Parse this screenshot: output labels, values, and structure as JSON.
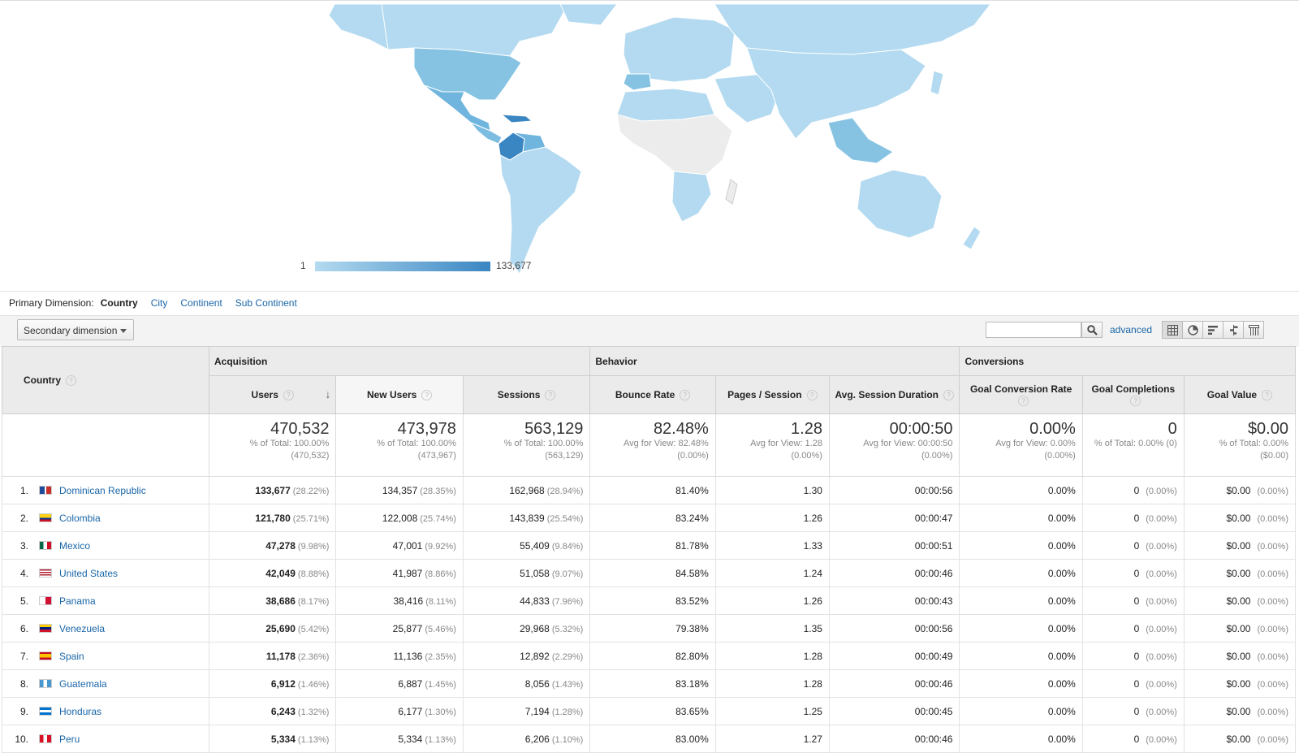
{
  "legend": {
    "min": "1",
    "max": "133,677",
    "color_low": "#b3daf0",
    "color_high": "#3a86c2"
  },
  "dimension": {
    "label": "Primary Dimension:",
    "current": "Country",
    "options": [
      "City",
      "Continent",
      "Sub Continent"
    ]
  },
  "toolbar": {
    "secondary_label": "Secondary dimension",
    "advanced_label": "advanced"
  },
  "table": {
    "country_header": "Country",
    "groups": {
      "acquisition": "Acquisition",
      "behavior": "Behavior",
      "conversions": "Conversions"
    },
    "columns": {
      "users": "Users",
      "new_users": "New Users",
      "sessions": "Sessions",
      "bounce_rate": "Bounce Rate",
      "pages_session": "Pages / Session",
      "avg_duration": "Avg. Session Duration",
      "goal_rate": "Goal Conversion Rate",
      "goal_completions": "Goal Completions",
      "goal_value": "Goal Value"
    },
    "totals": {
      "users": {
        "value": "470,532",
        "sub1": "% of Total: 100.00%",
        "sub2": "(470,532)"
      },
      "new_users": {
        "value": "473,978",
        "sub1": "% of Total: 100.00%",
        "sub2": "(473,967)"
      },
      "sessions": {
        "value": "563,129",
        "sub1": "% of Total: 100.00%",
        "sub2": "(563,129)"
      },
      "bounce_rate": {
        "value": "82.48%",
        "sub1": "Avg for View: 82.48%",
        "sub2": "(0.00%)"
      },
      "pages_session": {
        "value": "1.28",
        "sub1": "Avg for View: 1.28",
        "sub2": "(0.00%)"
      },
      "avg_duration": {
        "value": "00:00:50",
        "sub1": "Avg for View: 00:00:50",
        "sub2": "(0.00%)"
      },
      "goal_rate": {
        "value": "0.00%",
        "sub1": "Avg for View: 0.00%",
        "sub2": "(0.00%)"
      },
      "goal_completions": {
        "value": "0",
        "sub1": "% of Total: 0.00% (0)",
        "sub2": ""
      },
      "goal_value": {
        "value": "$0.00",
        "sub1": "% of Total: 0.00%",
        "sub2": "($0.00)"
      }
    },
    "rows": [
      {
        "n": "1.",
        "country": "Dominican Republic",
        "flag": "do",
        "users": "133,677",
        "users_pct": "(28.22%)",
        "new_users": "134,357",
        "new_users_pct": "(28.35%)",
        "sessions": "162,968",
        "sessions_pct": "(28.94%)",
        "bounce": "81.40%",
        "pps": "1.30",
        "dur": "00:00:56",
        "rate": "0.00%",
        "comp": "0",
        "comp_pct": "(0.00%)",
        "value": "$0.00",
        "value_pct": "(0.00%)"
      },
      {
        "n": "2.",
        "country": "Colombia",
        "flag": "co",
        "users": "121,780",
        "users_pct": "(25.71%)",
        "new_users": "122,008",
        "new_users_pct": "(25.74%)",
        "sessions": "143,839",
        "sessions_pct": "(25.54%)",
        "bounce": "83.24%",
        "pps": "1.26",
        "dur": "00:00:47",
        "rate": "0.00%",
        "comp": "0",
        "comp_pct": "(0.00%)",
        "value": "$0.00",
        "value_pct": "(0.00%)"
      },
      {
        "n": "3.",
        "country": "Mexico",
        "flag": "mx",
        "users": "47,278",
        "users_pct": "(9.98%)",
        "new_users": "47,001",
        "new_users_pct": "(9.92%)",
        "sessions": "55,409",
        "sessions_pct": "(9.84%)",
        "bounce": "81.78%",
        "pps": "1.33",
        "dur": "00:00:51",
        "rate": "0.00%",
        "comp": "0",
        "comp_pct": "(0.00%)",
        "value": "$0.00",
        "value_pct": "(0.00%)"
      },
      {
        "n": "4.",
        "country": "United States",
        "flag": "us",
        "users": "42,049",
        "users_pct": "(8.88%)",
        "new_users": "41,987",
        "new_users_pct": "(8.86%)",
        "sessions": "51,058",
        "sessions_pct": "(9.07%)",
        "bounce": "84.58%",
        "pps": "1.24",
        "dur": "00:00:46",
        "rate": "0.00%",
        "comp": "0",
        "comp_pct": "(0.00%)",
        "value": "$0.00",
        "value_pct": "(0.00%)"
      },
      {
        "n": "5.",
        "country": "Panama",
        "flag": "pa",
        "users": "38,686",
        "users_pct": "(8.17%)",
        "new_users": "38,416",
        "new_users_pct": "(8.11%)",
        "sessions": "44,833",
        "sessions_pct": "(7.96%)",
        "bounce": "83.52%",
        "pps": "1.26",
        "dur": "00:00:43",
        "rate": "0.00%",
        "comp": "0",
        "comp_pct": "(0.00%)",
        "value": "$0.00",
        "value_pct": "(0.00%)"
      },
      {
        "n": "6.",
        "country": "Venezuela",
        "flag": "ve",
        "users": "25,690",
        "users_pct": "(5.42%)",
        "new_users": "25,877",
        "new_users_pct": "(5.46%)",
        "sessions": "29,968",
        "sessions_pct": "(5.32%)",
        "bounce": "79.38%",
        "pps": "1.35",
        "dur": "00:00:56",
        "rate": "0.00%",
        "comp": "0",
        "comp_pct": "(0.00%)",
        "value": "$0.00",
        "value_pct": "(0.00%)"
      },
      {
        "n": "7.",
        "country": "Spain",
        "flag": "es",
        "users": "11,178",
        "users_pct": "(2.36%)",
        "new_users": "11,136",
        "new_users_pct": "(2.35%)",
        "sessions": "12,892",
        "sessions_pct": "(2.29%)",
        "bounce": "82.80%",
        "pps": "1.28",
        "dur": "00:00:49",
        "rate": "0.00%",
        "comp": "0",
        "comp_pct": "(0.00%)",
        "value": "$0.00",
        "value_pct": "(0.00%)"
      },
      {
        "n": "8.",
        "country": "Guatemala",
        "flag": "gt",
        "users": "6,912",
        "users_pct": "(1.46%)",
        "new_users": "6,887",
        "new_users_pct": "(1.45%)",
        "sessions": "8,056",
        "sessions_pct": "(1.43%)",
        "bounce": "83.18%",
        "pps": "1.28",
        "dur": "00:00:46",
        "rate": "0.00%",
        "comp": "0",
        "comp_pct": "(0.00%)",
        "value": "$0.00",
        "value_pct": "(0.00%)"
      },
      {
        "n": "9.",
        "country": "Honduras",
        "flag": "hn",
        "users": "6,243",
        "users_pct": "(1.32%)",
        "new_users": "6,177",
        "new_users_pct": "(1.30%)",
        "sessions": "7,194",
        "sessions_pct": "(1.28%)",
        "bounce": "83.65%",
        "pps": "1.25",
        "dur": "00:00:45",
        "rate": "0.00%",
        "comp": "0",
        "comp_pct": "(0.00%)",
        "value": "$0.00",
        "value_pct": "(0.00%)"
      },
      {
        "n": "10.",
        "country": "Peru",
        "flag": "pe",
        "users": "5,334",
        "users_pct": "(1.13%)",
        "new_users": "5,334",
        "new_users_pct": "(1.13%)",
        "sessions": "6,206",
        "sessions_pct": "(1.10%)",
        "bounce": "83.00%",
        "pps": "1.27",
        "dur": "00:00:46",
        "rate": "0.00%",
        "comp": "0",
        "comp_pct": "(0.00%)",
        "value": "$0.00",
        "value_pct": "(0.00%)"
      }
    ]
  }
}
